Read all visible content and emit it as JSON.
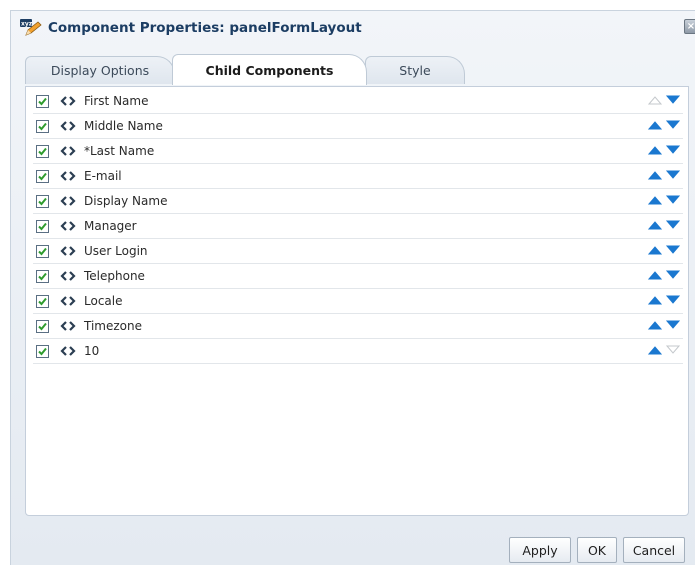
{
  "dialog": {
    "title": "Component Properties: panelFormLayout",
    "title_icon": "xyz-pencil-icon",
    "close_label": "×"
  },
  "tabs": [
    {
      "label": "Display Options",
      "active": false
    },
    {
      "label": "Child Components",
      "active": true
    },
    {
      "label": "Style",
      "active": false
    }
  ],
  "rows": [
    {
      "label": "First Name",
      "checked": true,
      "up_enabled": false,
      "down_enabled": true
    },
    {
      "label": "Middle Name",
      "checked": true,
      "up_enabled": true,
      "down_enabled": true
    },
    {
      "label": "*Last Name",
      "checked": true,
      "up_enabled": true,
      "down_enabled": true
    },
    {
      "label": "E-mail",
      "checked": true,
      "up_enabled": true,
      "down_enabled": true
    },
    {
      "label": "Display Name",
      "checked": true,
      "up_enabled": true,
      "down_enabled": true
    },
    {
      "label": "Manager",
      "checked": true,
      "up_enabled": true,
      "down_enabled": true
    },
    {
      "label": "User Login",
      "checked": true,
      "up_enabled": true,
      "down_enabled": true
    },
    {
      "label": "Telephone",
      "checked": true,
      "up_enabled": true,
      "down_enabled": true
    },
    {
      "label": "Locale",
      "checked": true,
      "up_enabled": true,
      "down_enabled": true
    },
    {
      "label": "Timezone",
      "checked": true,
      "up_enabled": true,
      "down_enabled": true
    },
    {
      "label": "10",
      "checked": true,
      "up_enabled": true,
      "down_enabled": false
    }
  ],
  "buttons": {
    "apply": "Apply",
    "ok": "OK",
    "cancel": "Cancel"
  },
  "colors": {
    "arrow_enabled": "#1b78d0",
    "arrow_disabled": "#c4c8cc",
    "check": "#2e9c2e",
    "title": "#1c3d63"
  }
}
